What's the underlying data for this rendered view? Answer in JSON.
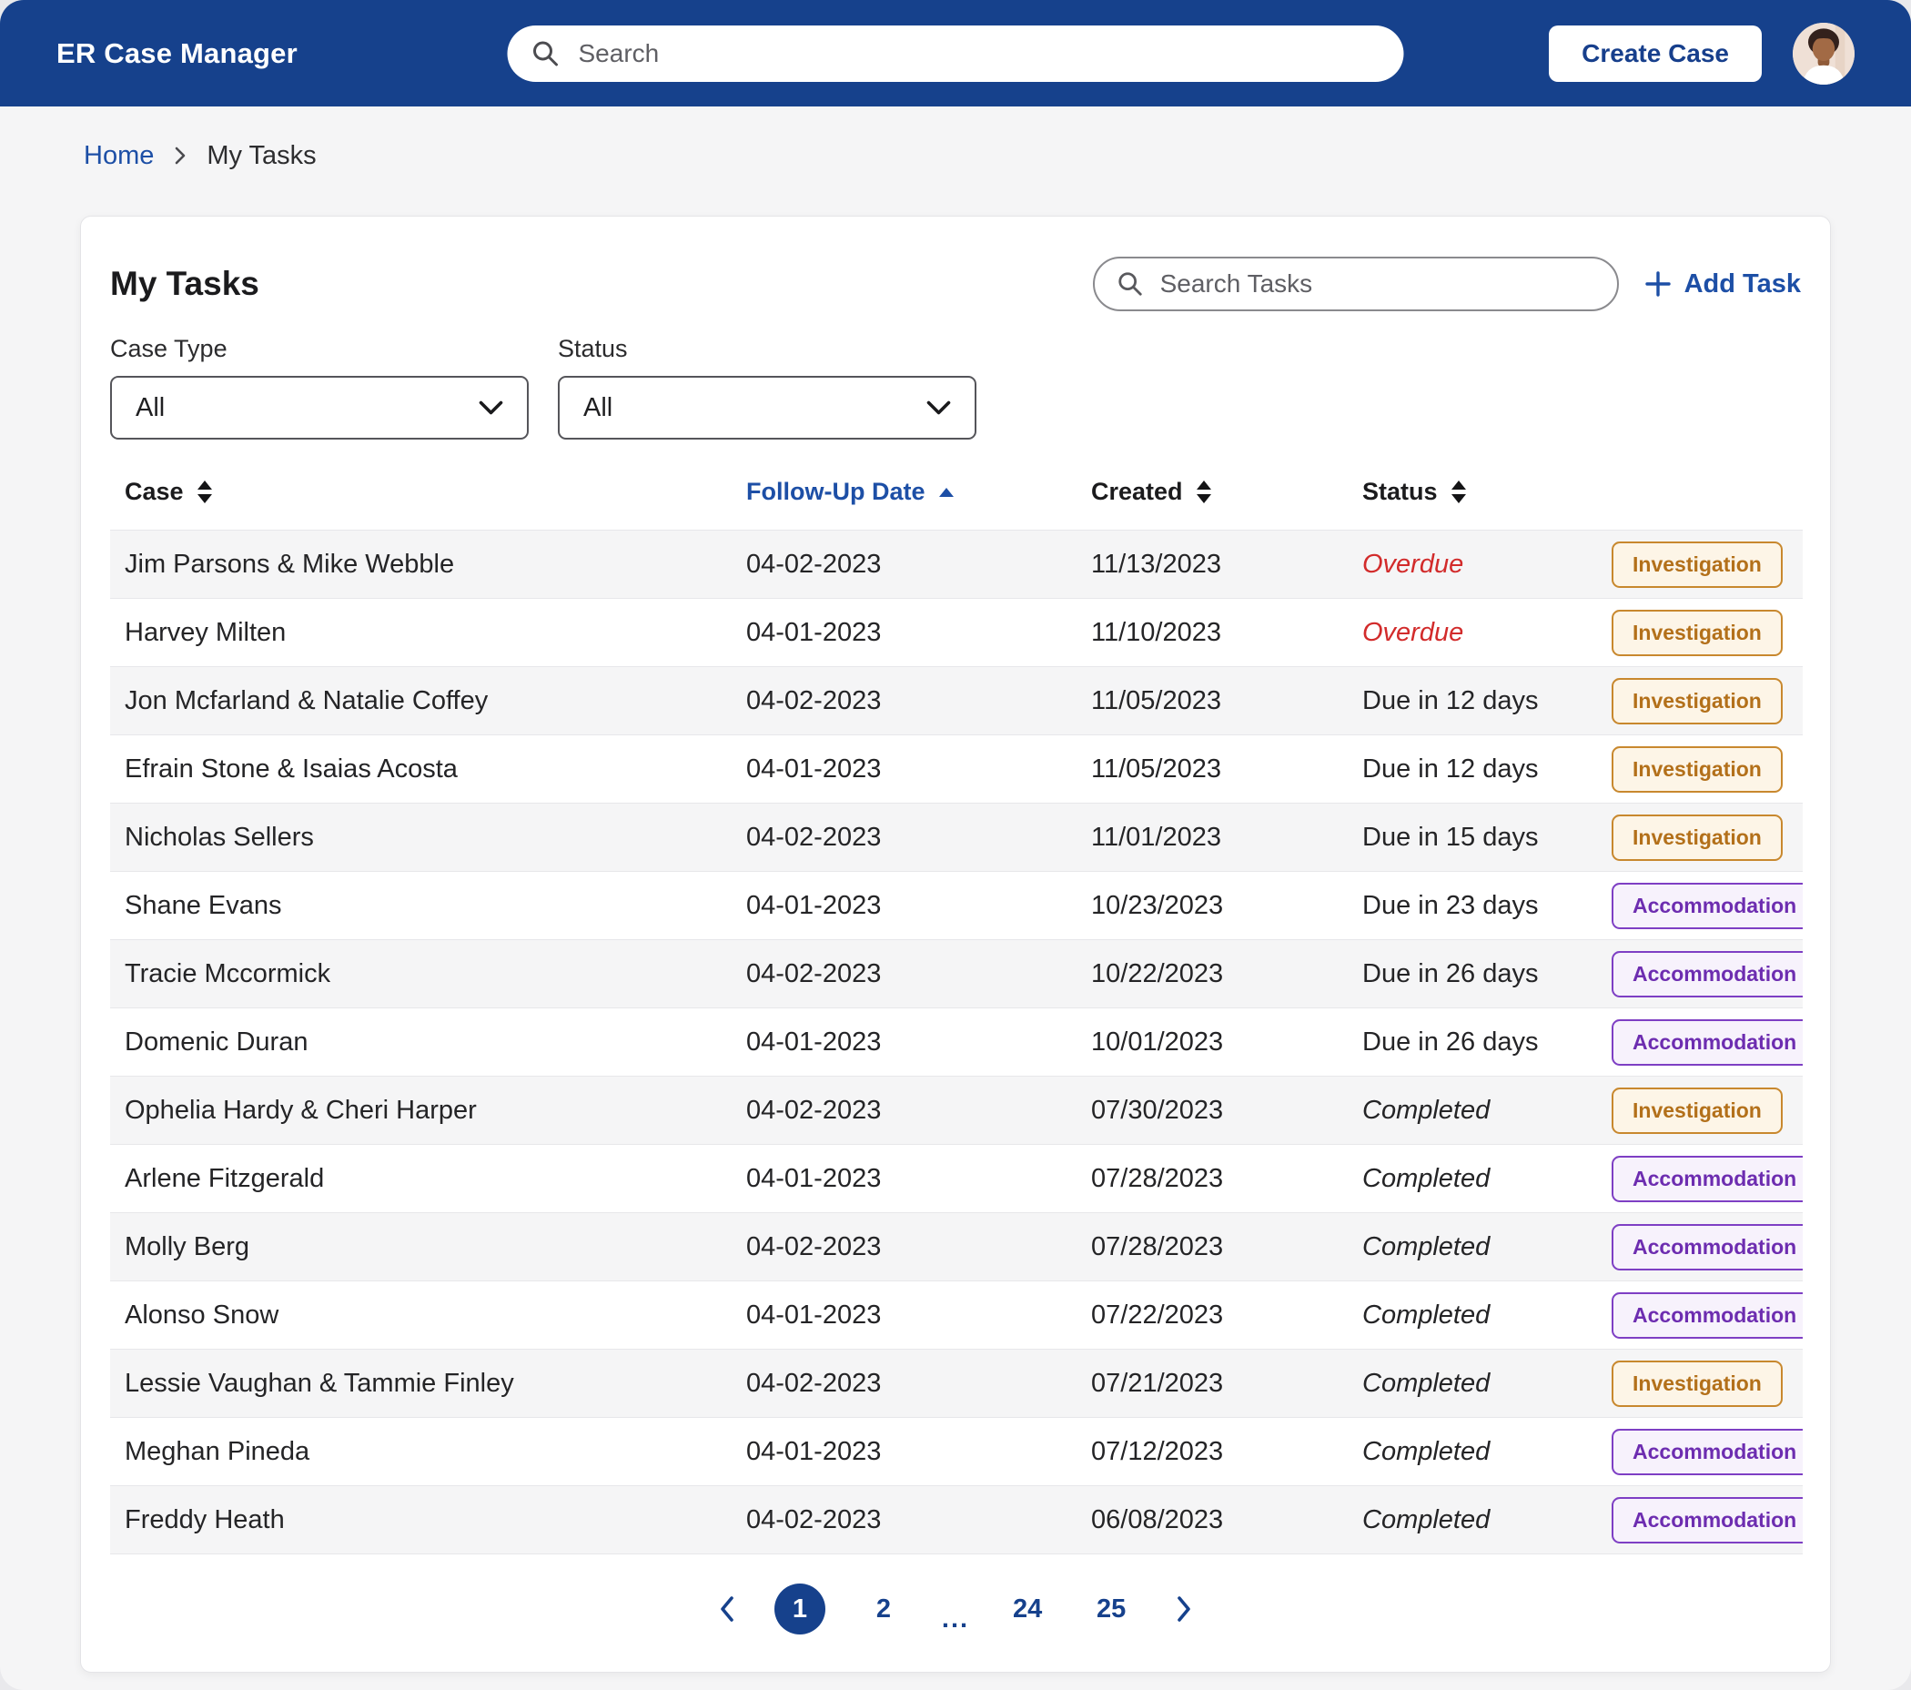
{
  "header": {
    "app_title": "ER Case Manager",
    "search_placeholder": "Search",
    "create_case_label": "Create Case"
  },
  "breadcrumb": {
    "home": "Home",
    "current": "My Tasks"
  },
  "panel": {
    "title": "My Tasks",
    "search_placeholder": "Search Tasks",
    "add_task_label": "Add Task",
    "filters": [
      {
        "label": "Case Type",
        "value": "All"
      },
      {
        "label": "Status",
        "value": "All"
      }
    ],
    "columns": [
      "Case",
      "Follow-Up Date",
      "Created",
      "Status"
    ],
    "sort": {
      "column": "Follow-Up Date",
      "direction": "asc"
    },
    "rows": [
      {
        "case": "Jim Parsons & Mike Webble",
        "follow_up": "04-02-2023",
        "created": "11/13/2023",
        "status": "Overdue",
        "status_style": "overdue",
        "type": "Investigation"
      },
      {
        "case": "Harvey Milten",
        "follow_up": "04-01-2023",
        "created": "11/10/2023",
        "status": "Overdue",
        "status_style": "overdue",
        "type": "Investigation"
      },
      {
        "case": "Jon Mcfarland & Natalie Coffey",
        "follow_up": "04-02-2023",
        "created": "11/05/2023",
        "status": "Due in 12 days",
        "status_style": "due",
        "type": "Investigation"
      },
      {
        "case": "Efrain Stone & Isaias Acosta",
        "follow_up": "04-01-2023",
        "created": "11/05/2023",
        "status": "Due in 12 days",
        "status_style": "due",
        "type": "Investigation"
      },
      {
        "case": "Nicholas Sellers",
        "follow_up": "04-02-2023",
        "created": "11/01/2023",
        "status": "Due in 15 days",
        "status_style": "due",
        "type": "Investigation"
      },
      {
        "case": "Shane Evans",
        "follow_up": "04-01-2023",
        "created": "10/23/2023",
        "status": "Due in 23 days",
        "status_style": "due",
        "type": "Accommodation"
      },
      {
        "case": "Tracie Mccormick",
        "follow_up": "04-02-2023",
        "created": "10/22/2023",
        "status": "Due in 26 days",
        "status_style": "due",
        "type": "Accommodation"
      },
      {
        "case": "Domenic Duran",
        "follow_up": "04-01-2023",
        "created": "10/01/2023",
        "status": "Due in 26 days",
        "status_style": "due",
        "type": "Accommodation"
      },
      {
        "case": "Ophelia Hardy & Cheri Harper",
        "follow_up": "04-02-2023",
        "created": "07/30/2023",
        "status": "Completed",
        "status_style": "completed",
        "type": "Investigation"
      },
      {
        "case": "Arlene Fitzgerald",
        "follow_up": "04-01-2023",
        "created": "07/28/2023",
        "status": "Completed",
        "status_style": "completed",
        "type": "Accommodation"
      },
      {
        "case": "Molly Berg",
        "follow_up": "04-02-2023",
        "created": "07/28/2023",
        "status": "Completed",
        "status_style": "completed",
        "type": "Accommodation"
      },
      {
        "case": "Alonso Snow",
        "follow_up": "04-01-2023",
        "created": "07/22/2023",
        "status": "Completed",
        "status_style": "completed",
        "type": "Accommodation"
      },
      {
        "case": "Lessie Vaughan & Tammie Finley",
        "follow_up": "04-02-2023",
        "created": "07/21/2023",
        "status": "Completed",
        "status_style": "completed",
        "type": "Investigation"
      },
      {
        "case": "Meghan Pineda",
        "follow_up": "04-01-2023",
        "created": "07/12/2023",
        "status": "Completed",
        "status_style": "completed",
        "type": "Accommodation"
      },
      {
        "case": "Freddy Heath",
        "follow_up": "04-02-2023",
        "created": "06/08/2023",
        "status": "Completed",
        "status_style": "completed",
        "type": "Accommodation"
      }
    ],
    "pagination": {
      "pages": [
        "1",
        "2",
        "...",
        "24",
        "25"
      ],
      "current": "1"
    }
  },
  "colors": {
    "header_blue": "#16418C",
    "link_blue": "#1D4FA6",
    "overdue_red": "#D22B2B",
    "investigation_orange": "#B3701A",
    "accommodation_purple": "#6D2DB0",
    "row_stripe": "#F5F5F6"
  }
}
